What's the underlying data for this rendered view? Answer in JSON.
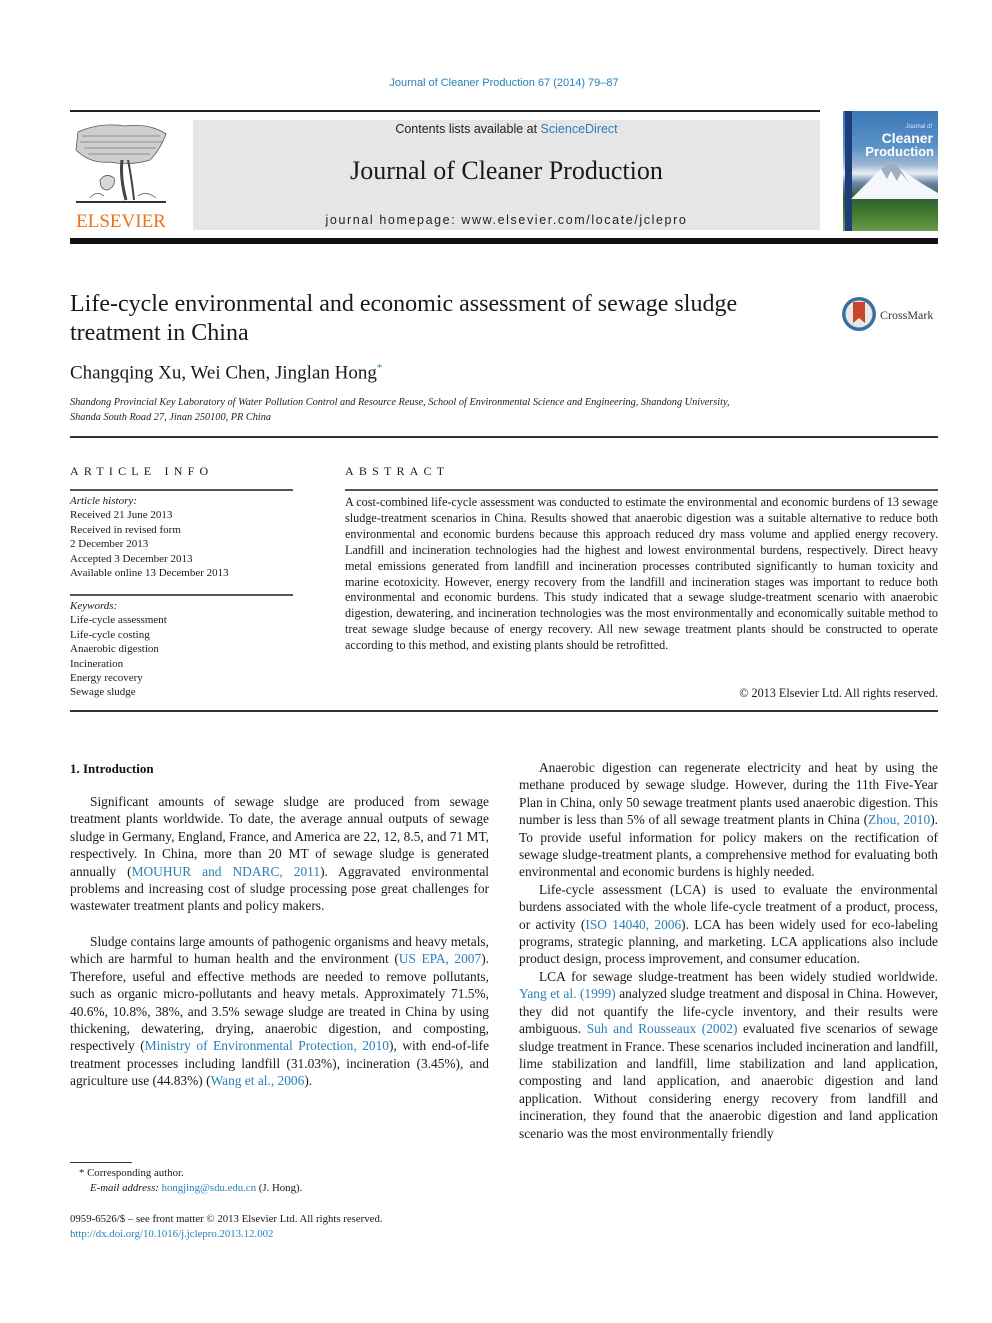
{
  "header": {
    "citation": "Journal of Cleaner Production 67 (2014) 79–87",
    "contents_prefix": "Contents lists available at ",
    "contents_link": "ScienceDirect",
    "journal_name": "Journal of Cleaner Production",
    "homepage": "journal homepage: www.elsevier.com/locate/jclepro",
    "publisher_logo_text": "ELSEVIER",
    "cover": {
      "small_title": "Journal of",
      "title_line_1": "Cleaner",
      "title_line_2": "Production"
    },
    "colors": {
      "link": "#2a7fb8",
      "elsevier_orange": "#e8731c",
      "masthead_bg": "#e6e6e6"
    }
  },
  "article": {
    "title": "Life-cycle environmental and economic assessment of sewage sludge treatment in China",
    "crossmark_label": "CrossMark",
    "authors": "Changqing Xu, Wei Chen, Jinglan Hong",
    "corresponding_marker": "*",
    "affiliation_line_1": "Shandong Provincial Key Laboratory of Water Pollution Control and Resource Reuse, School of Environmental Science and Engineering, Shandong University,",
    "affiliation_line_2": "Shanda South Road 27, Jinan 250100, PR China"
  },
  "article_info": {
    "heading": "ARTICLE INFO",
    "history_label": "Article history:",
    "history": [
      "Received 21 June 2013",
      "Received in revised form",
      "2 December 2013",
      "Accepted 3 December 2013",
      "Available online 13 December 2013"
    ],
    "keywords_label": "Keywords:",
    "keywords": [
      "Life-cycle assessment",
      "Life-cycle costing",
      "Anaerobic digestion",
      "Incineration",
      "Energy recovery",
      "Sewage sludge"
    ]
  },
  "abstract": {
    "heading": "ABSTRACT",
    "text": "A cost-combined life-cycle assessment was conducted to estimate the environmental and economic burdens of 13 sewage sludge-treatment scenarios in China. Results showed that anaerobic digestion was a suitable alternative to reduce both environmental and economic burdens because this approach reduced dry mass volume and applied energy recovery. Landfill and incineration technologies had the highest and lowest environmental burdens, respectively. Direct heavy metal emissions generated from landfill and incineration processes contributed significantly to human toxicity and marine ecotoxicity. However, energy recovery from the landfill and incineration stages was important to reduce both environmental and economic burdens. This study indicated that a sewage sludge-treatment scenario with anaerobic digestion, dewatering, and incineration technologies was the most environmentally and economically suitable method to treat sewage sludge because of energy recovery. All new sewage treatment plants should be constructed to operate according to this method, and existing plants should be retrofitted.",
    "copyright": "© 2013 Elsevier Ltd. All rights reserved."
  },
  "introduction": {
    "heading": "1.  Introduction",
    "p1": {
      "t1": "Significant amounts of sewage sludge are produced from sewage treatment plants worldwide. To date, the average annual outputs of sewage sludge in Germany, England, France, and America are 22, 12, 8.5, and 71 MT, respectively. In China, more than 20 MT of sewage sludge is generated annually (",
      "ref1": "MOUHUR and NDARC, 2011",
      "t2": "). Aggravated environmental problems and increasing cost of sludge processing pose great challenges for wastewater treatment plants and policy makers."
    },
    "p2": {
      "t1": "Sludge contains large amounts of pathogenic organisms and heavy metals, which are harmful to human health and the environment (",
      "ref1": "US EPA, 2007",
      "t2": "). Therefore, useful and effective methods are needed to remove pollutants, such as organic micro-pollutants and heavy metals. Approximately 71.5%, 40.6%, 10.8%, 38%, and 3.5% sewage sludge are treated in China by using thickening, dewatering, drying, anaerobic digestion, and composting, respectively (",
      "ref2": "Ministry of Environmental Protection, 2010",
      "t3": "), with end-of-life treatment processes including landfill (31.03%), incineration (3.45%), and agriculture use (44.83%) (",
      "ref3": "Wang et al., 2006",
      "t4": ")."
    },
    "p3": {
      "t1": "Anaerobic digestion can regenerate electricity and heat by using the methane produced by sewage sludge. However, during the 11th Five-Year Plan in China, only 50 sewage treatment plants used anaerobic digestion. This number is less than 5% of all sewage treatment plants in China (",
      "ref1": "Zhou, 2010",
      "t2": "). To provide useful information for policy makers on the rectification of sewage sludge-treatment plants, a comprehensive method for evaluating both environmental and economic burdens is highly needed."
    },
    "p4": {
      "t1": "Life-cycle assessment (LCA) is used to evaluate the environmental burdens associated with the whole life-cycle treatment of a product, process, or activity (",
      "ref1": "ISO 14040, 2006",
      "t2": "). LCA has been widely used for eco-labeling programs, strategic planning, and marketing. LCA applications also include product design, process improvement, and consumer education."
    },
    "p5": {
      "t1": "LCA for sewage sludge-treatment has been widely studied worldwide. ",
      "ref1": "Yang et al. (1999)",
      "t2": " analyzed sludge treatment and disposal in China. However, they did not quantify the life-cycle inventory, and their results were ambiguous. ",
      "ref2": "Suh and Rousseaux (2002)",
      "t3": " evaluated five scenarios of sewage sludge treatment in France. These scenarios included incineration and landfill, lime stabilization and landfill, lime stabilization and land application, composting and land application, and anaerobic digestion and land application. Without considering energy recovery from landfill and incineration, they found that the anaerobic digestion and land application scenario was the most environmentally friendly"
    }
  },
  "footnote": {
    "marker": "*",
    "corresponding": "Corresponding author.",
    "email_label": "E-mail address: ",
    "email": "hongjing@sdu.edu.cn",
    "email_suffix": " (J. Hong)."
  },
  "front_matter": {
    "issn_line": "0959-6526/$ – see front matter © 2013 Elsevier Ltd. All rights reserved.",
    "doi": "http://dx.doi.org/10.1016/j.jclepro.2013.12.002"
  }
}
